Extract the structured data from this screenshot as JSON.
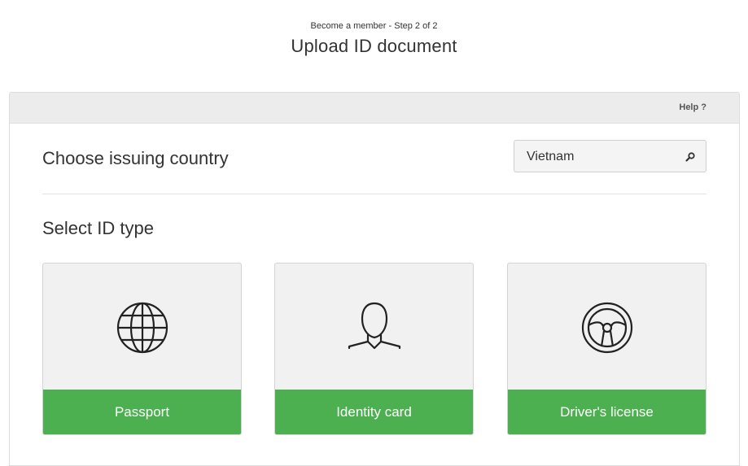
{
  "header": {
    "step": "Become a member - Step 2 of 2",
    "title": "Upload ID document"
  },
  "panel": {
    "help_label": "Help ?",
    "country_label": "Choose issuing country",
    "country_value": "Vietnam",
    "idtype_label": "Select ID type",
    "cards": [
      {
        "label": "Passport",
        "icon": "globe-icon"
      },
      {
        "label": "Identity card",
        "icon": "person-icon"
      },
      {
        "label": "Driver's license",
        "icon": "steering-wheel-icon"
      }
    ]
  },
  "colors": {
    "accent_green": "#4caf50",
    "card_bg": "#f1f1f1",
    "bar_bg": "#ececec"
  }
}
